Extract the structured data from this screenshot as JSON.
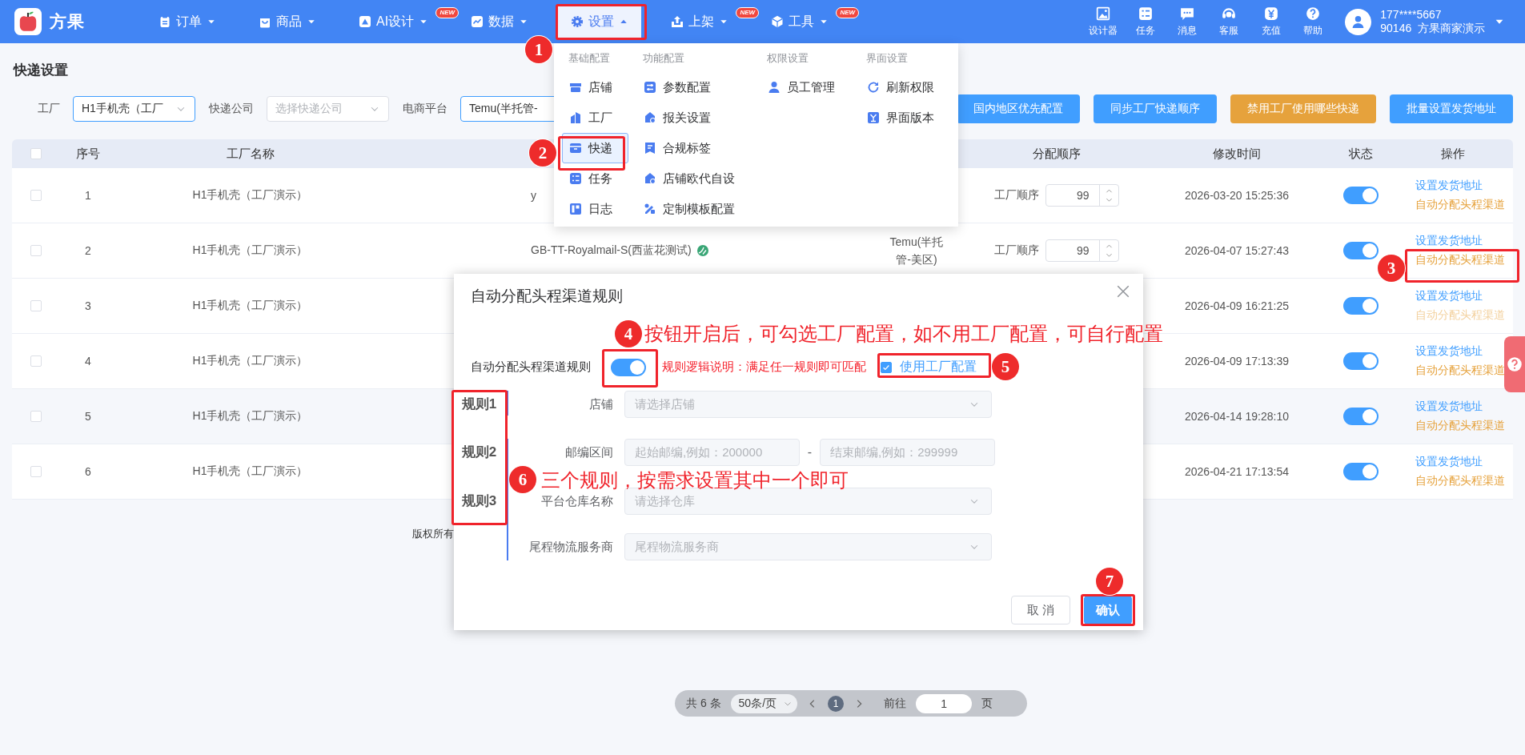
{
  "header": {
    "logo": "方果",
    "nav": [
      {
        "label": "订单",
        "selected": false,
        "expanded": false
      },
      {
        "label": "商品",
        "selected": false,
        "expanded": false
      },
      {
        "label": "AI设计",
        "badge": "NEW",
        "selected": false,
        "expanded": false
      },
      {
        "label": "数据",
        "selected": false,
        "expanded": false
      },
      {
        "label": "设置",
        "selected": true,
        "expanded": true
      },
      {
        "label": "上架",
        "badge": "NEW",
        "selected": false,
        "expanded": false
      },
      {
        "label": "工具",
        "badge": "NEW",
        "selected": false,
        "expanded": false
      }
    ],
    "tools": [
      {
        "label": "设计器"
      },
      {
        "label": "任务"
      },
      {
        "label": "消息"
      },
      {
        "label": "客服"
      },
      {
        "label": "充值"
      },
      {
        "label": "帮助"
      }
    ],
    "user": {
      "phone": "177****5667",
      "name": "90146  方果商家演示"
    }
  },
  "page_title": "快递设置",
  "filters": [
    {
      "label": "工厂",
      "value": "H1手机壳（工厂",
      "active": true
    },
    {
      "label": "快递公司",
      "placeholder": "选择快递公司",
      "active": false
    },
    {
      "label": "电商平台",
      "value": "Temu(半托管-",
      "active": true
    }
  ],
  "buttons": [
    {
      "label": "国内地区优先配置",
      "kind": "primary"
    },
    {
      "label": "同步工厂快递顺序",
      "kind": "primary"
    },
    {
      "label": "禁用工厂使用哪些快递",
      "kind": "warning"
    },
    {
      "label": "批量设置发货地址",
      "kind": "primary"
    }
  ],
  "table": {
    "select_all_checked": false,
    "columns": [
      {
        "label": "序号"
      },
      {
        "label": "工厂名称"
      },
      {
        "label": "分配顺序"
      },
      {
        "label": "修改时间"
      },
      {
        "label": "状态"
      },
      {
        "label": "操作"
      }
    ],
    "rows": [
      {
        "seq": "1",
        "factory": "H1手机壳（工厂演示）",
        "express": "y",
        "express_icon": false,
        "order_label": "工厂顺序",
        "order": "99",
        "time": "2026-03-20 15:25:36",
        "enabled": true,
        "checked": false,
        "highlighted": false,
        "links": [
          {
            "text": "设置发货地址",
            "kind": "primary",
            "faded": false
          },
          {
            "text": "自动分配头程渠道",
            "kind": "warning",
            "faded": false
          }
        ]
      },
      {
        "seq": "2",
        "factory": "H1手机壳（工厂演示）",
        "express": "GB-TT-Royalmail-S(西蓝花测试)",
        "express_icon": true,
        "platform": "Temu(半托管-美区)",
        "order_label": "工厂顺序",
        "order": "99",
        "time": "2026-04-07 15:27:43",
        "enabled": true,
        "checked": false,
        "highlighted": false,
        "links": [
          {
            "text": "设置发货地址",
            "kind": "primary",
            "faded": false
          },
          {
            "text": "自动分配头程渠道",
            "kind": "warning",
            "faded": false
          }
        ]
      },
      {
        "seq": "3",
        "factory": "H1手机壳（工厂演示）",
        "time": "2026-04-09 16:21:25",
        "enabled": true,
        "checked": false,
        "highlighted": false,
        "links": [
          {
            "text": "设置发货地址",
            "kind": "primary",
            "faded": false
          },
          {
            "text": "自动分配头程渠道",
            "kind": "warning",
            "faded": true
          }
        ]
      },
      {
        "seq": "4",
        "factory": "H1手机壳（工厂演示）",
        "time": "2026-04-09 17:13:39",
        "enabled": true,
        "checked": false,
        "highlighted": false,
        "links": [
          {
            "text": "设置发货地址",
            "kind": "primary",
            "faded": false
          },
          {
            "text": "自动分配头程渠道",
            "kind": "warning",
            "faded": false
          }
        ]
      },
      {
        "seq": "5",
        "factory": "H1手机壳（工厂演示）",
        "time": "2026-04-14 19:28:10",
        "enabled": true,
        "checked": false,
        "highlighted": true,
        "links": [
          {
            "text": "设置发货地址",
            "kind": "primary",
            "faded": false
          },
          {
            "text": "自动分配头程渠道",
            "kind": "warning",
            "faded": false
          }
        ]
      },
      {
        "seq": "6",
        "factory": "H1手机壳（工厂演示）",
        "time": "2026-04-21 17:13:54",
        "enabled": true,
        "checked": false,
        "highlighted": false,
        "links": [
          {
            "text": "设置发货地址",
            "kind": "primary",
            "faded": false
          },
          {
            "text": "自动分配头程渠道",
            "kind": "warning",
            "faded": false
          }
        ]
      }
    ]
  },
  "footer": "版权所有",
  "pagination": {
    "total": "共 6 条",
    "page_size": "50条/页",
    "pages": [
      {
        "label": "1",
        "selected": true
      }
    ],
    "goto_label": "前往",
    "goto_value": "1",
    "goto_suffix": "页"
  },
  "menu": {
    "columns": [
      {
        "heading": "基础配置",
        "items": [
          {
            "label": "店铺",
            "selected": false
          },
          {
            "label": "工厂",
            "selected": false
          },
          {
            "label": "快递",
            "selected": true
          },
          {
            "label": "任务",
            "selected": false
          },
          {
            "label": "日志",
            "selected": false
          }
        ]
      },
      {
        "heading": "功能配置",
        "items": [
          {
            "label": "参数配置",
            "selected": false
          },
          {
            "label": "报关设置",
            "selected": false
          },
          {
            "label": "合规标签",
            "selected": false
          },
          {
            "label": "店铺欧代自设",
            "selected": false
          },
          {
            "label": "定制模板配置",
            "selected": false
          }
        ]
      },
      {
        "heading": "权限设置",
        "items": [
          {
            "label": "员工管理",
            "selected": false
          }
        ]
      },
      {
        "heading": "界面设置",
        "items": [
          {
            "label": "刷新权限",
            "selected": false
          },
          {
            "label": "界面版本",
            "selected": false
          }
        ]
      }
    ]
  },
  "dialog": {
    "title": "自动分配头程渠道规则",
    "switch_label": "自动分配头程渠道规则",
    "switch_on": true,
    "hint": "规则逻辑说明：满足任一规则即可匹配",
    "use_factory": {
      "label": "使用工厂配置",
      "checked": true
    },
    "rules": [
      {
        "label": "规则1"
      },
      {
        "label": "规则2"
      },
      {
        "label": "规则3"
      }
    ],
    "fields": [
      {
        "label": "店铺",
        "kind": "select",
        "placeholder": "请选择店铺"
      },
      {
        "label": "邮编区间",
        "kind": "range",
        "placeholder": "起始邮编,例如：200000",
        "separator": "-",
        "placeholder_end": "结束邮编,例如：299999"
      },
      {
        "label": "平台仓库名称",
        "kind": "select",
        "placeholder": "请选择仓库"
      },
      {
        "label": "尾程物流服务商",
        "kind": "select",
        "placeholder": "尾程物流服务商"
      }
    ],
    "buttons": [
      {
        "label": "取 消",
        "kind": "default"
      },
      {
        "label": "确认",
        "kind": "primary"
      }
    ]
  },
  "annotations": {
    "badges": [
      {
        "number": "1",
        "framed": true
      },
      {
        "number": "2",
        "framed": true
      },
      {
        "number": "3",
        "framed": true
      },
      {
        "number": "4",
        "framed": true
      },
      {
        "number": "5",
        "framed": true
      },
      {
        "number": "6",
        "framed": true
      },
      {
        "number": "7",
        "framed": true
      }
    ],
    "notes": [
      {
        "text": "按钮开启后，可勾选工厂配置，如不用工厂配置，可自行配置"
      },
      {
        "text": "三个规则，按需求设置其中一个即可"
      }
    ]
  }
}
